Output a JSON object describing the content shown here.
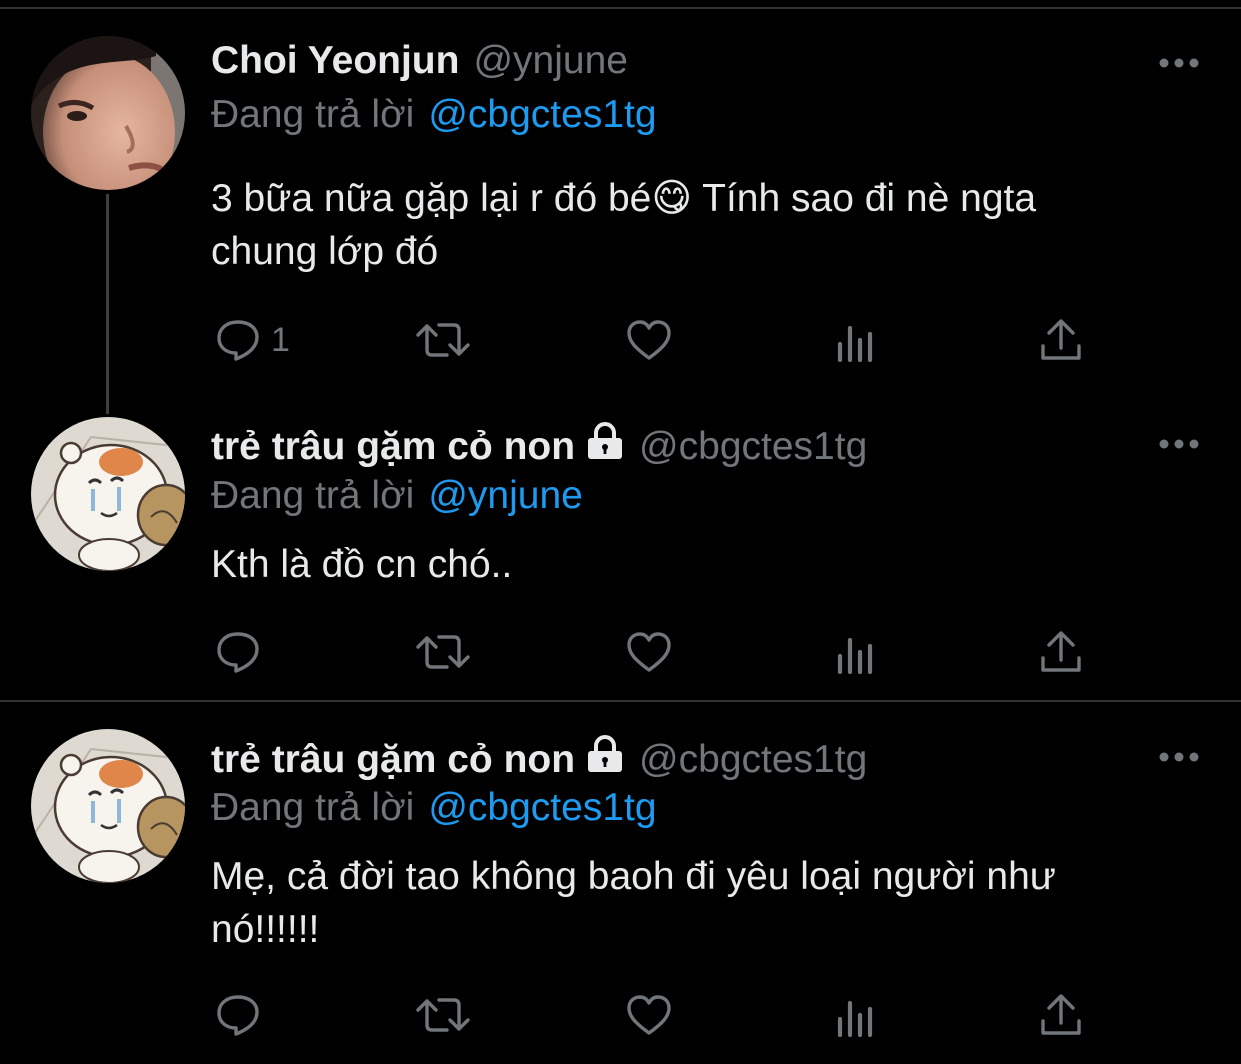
{
  "tweets": [
    {
      "name": "Choi Yeonjun",
      "locked": false,
      "handle": "@ynjune",
      "reply_label": "Đang trả lời",
      "reply_to": "@cbgctes1tg",
      "text_lines": [
        "3 bữa nữa gặp lại r đó bé😋  Tính sao đi nè ngta",
        "chung lớp đó"
      ],
      "reply_count": "1"
    },
    {
      "name": "trẻ trâu gặm cỏ non",
      "locked": true,
      "handle": "@cbgctes1tg",
      "reply_label": "Đang trả lời",
      "reply_to": "@ynjune",
      "text_lines": [
        "Kth là đồ cn chó.."
      ],
      "reply_count": ""
    },
    {
      "name": "trẻ trâu gặm cỏ non",
      "locked": true,
      "handle": "@cbgctes1tg",
      "reply_label": "Đang trả lời",
      "reply_to": "@cbgctes1tg",
      "text_lines": [
        "Mẹ, cả đời tao không baoh đi yêu loại người như",
        "nó!!!!!!"
      ],
      "reply_count": ""
    }
  ],
  "icons": {
    "more": "more-icon",
    "reply": "reply-icon",
    "retweet": "retweet-icon",
    "like": "heart-icon",
    "views": "views-icon",
    "share": "share-icon",
    "lock": "lock-icon"
  },
  "colors": {
    "background": "#000000",
    "text": "#e7e9ea",
    "secondary": "#71767b",
    "link": "#1d9bf0",
    "divider": "#2f3336"
  }
}
